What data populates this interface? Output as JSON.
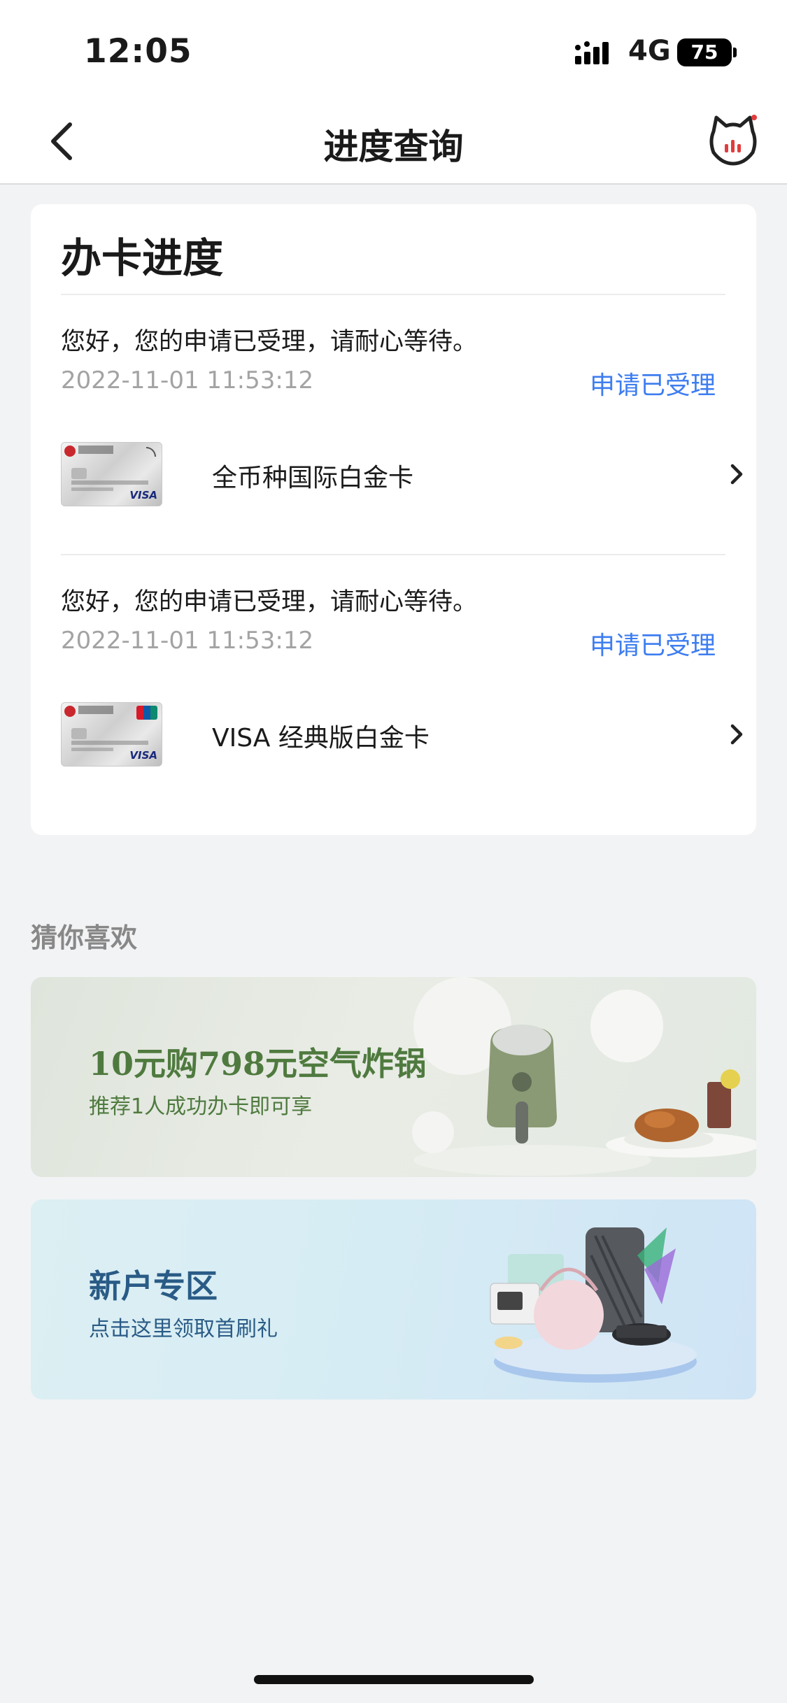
{
  "status_bar": {
    "time": "12:05",
    "network": "4G",
    "battery": "75"
  },
  "nav": {
    "title": "进度查询",
    "back_icon": "chevron-left-icon",
    "service_icon": "cat-service-icon"
  },
  "progress_card": {
    "title": "办卡进度",
    "applications": [
      {
        "message": "您好，您的申请已受理，请耐心等待。",
        "date": "2022-11-01 11:53:12",
        "status": "申请已受理",
        "card_name": "全币种国际白金卡"
      },
      {
        "message": "您好，您的申请已受理，请耐心等待。",
        "date": "2022-11-01 11:53:12",
        "status": "申请已受理",
        "card_name": "VISA 经典版白金卡"
      }
    ]
  },
  "recommend": {
    "title": "猜你喜欢",
    "banners": [
      {
        "title": "10元购798元空气炸锅",
        "subtitle": "推荐1人成功办卡即可享"
      },
      {
        "title": "新户专区",
        "subtitle": "点击这里领取首刷礼"
      }
    ]
  },
  "colors": {
    "accent": "#3d7df0",
    "background": "#f2f3f5",
    "banner1_text": "#4f7a3f",
    "banner2_text": "#2a5b86"
  }
}
